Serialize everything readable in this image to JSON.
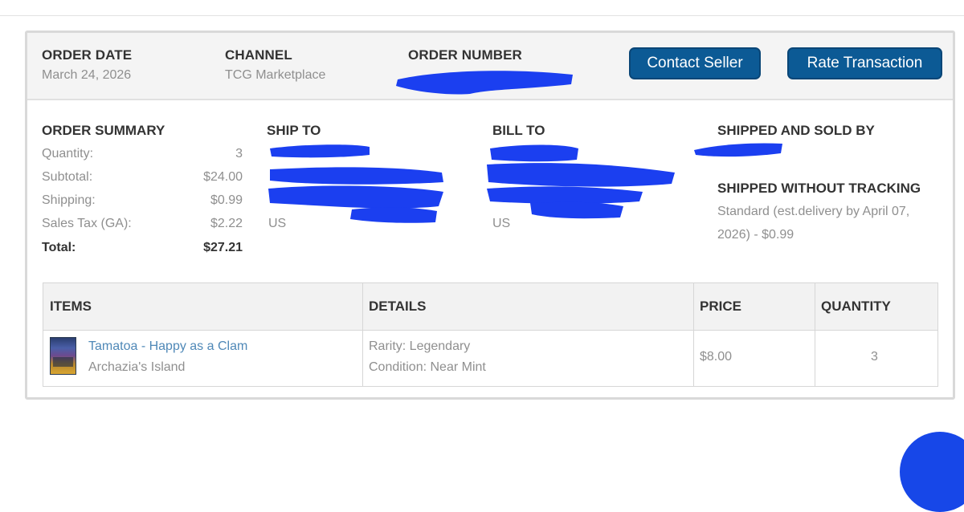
{
  "header": {
    "order_date_label": "ORDER DATE",
    "order_date_value": "March 24, 2026",
    "channel_label": "CHANNEL",
    "channel_value": "TCG Marketplace",
    "order_number_label": "ORDER NUMBER",
    "contact_button": "Contact Seller",
    "rate_button": "Rate Transaction"
  },
  "summary": {
    "label": "ORDER SUMMARY",
    "rows": [
      {
        "k": "Quantity:",
        "v": "3"
      },
      {
        "k": "Subtotal:",
        "v": "$24.00"
      },
      {
        "k": "Shipping:",
        "v": "$0.99"
      },
      {
        "k": "Sales Tax (GA):",
        "v": "$2.22"
      },
      {
        "k": "Total:",
        "v": "$27.21"
      }
    ]
  },
  "ship_to": {
    "label": "SHIP TO",
    "country": "US"
  },
  "bill_to": {
    "label": "BILL TO",
    "country": "US"
  },
  "seller": {
    "label": "SHIPPED AND SOLD BY",
    "tracking_label": "SHIPPED WITHOUT TRACKING",
    "shipping_line1": "Standard (est.delivery by April 07,",
    "shipping_line2": "2026) - $0.99"
  },
  "items_table": {
    "headers": [
      "ITEMS",
      "DETAILS",
      "PRICE",
      "QUANTITY"
    ],
    "rows": [
      {
        "name": "Tamatoa - Happy as a Clam",
        "set": "Archazia's Island",
        "rarity": "Rarity: Legendary",
        "condition": "Condition: Near Mint",
        "price": "$8.00",
        "quantity": "3"
      }
    ]
  },
  "colors": {
    "button_bg": "#0c5a95",
    "link": "#4f88b7",
    "redaction": "#1b3ff0"
  }
}
